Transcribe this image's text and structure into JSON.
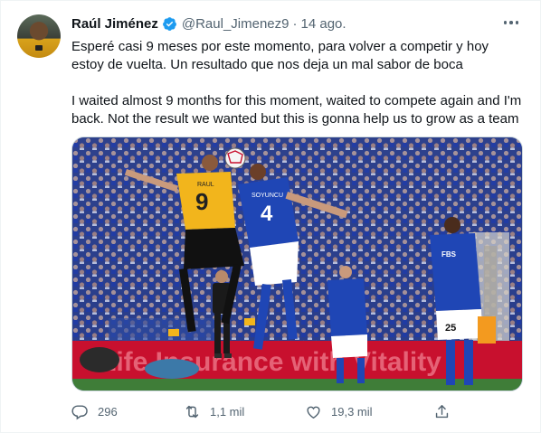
{
  "author": {
    "name": "Raúl Jiménez",
    "handle": "@Raul_Jimenez9",
    "separator": "·",
    "date": "14 ago."
  },
  "tweet": {
    "text_es": "Esperé casi 9 meses por este momento, para volver a competir y hoy estoy de vuelta. Un resultado que nos deja un mal sabor de boca",
    "text_en": "I waited almost 9 months for this moment, waited to compete again and I'm back. Not the result we wanted but this is gonna help us to grow as a team"
  },
  "media": {
    "player_left_name": "RAUL",
    "player_left_number": "9",
    "player_right_name": "SOYUNCU",
    "player_right_number": "4",
    "sponsor_badge": "FBS",
    "player_back_number": "25",
    "board_text": "Life Insurance  with Vitality"
  },
  "actions": {
    "replies": "296",
    "retweets": "1,1 mil",
    "likes": "19,3 mil"
  },
  "colors": {
    "verified": "#1d9bf0",
    "wolves_gold": "#f2b51c",
    "leicester_blue": "#1f46b5",
    "board_red": "#c8102e"
  },
  "icons": {
    "reply": "reply-icon",
    "retweet": "retweet-icon",
    "like": "heart-icon",
    "share": "share-icon",
    "more": "more-icon",
    "verified": "verified-badge-icon"
  }
}
